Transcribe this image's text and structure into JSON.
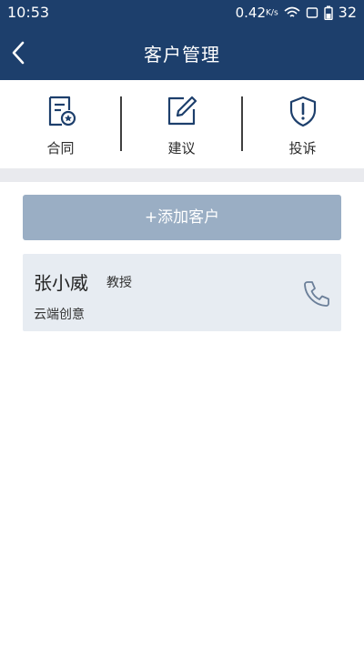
{
  "status_bar": {
    "time": "10:53",
    "network_speed": "0.42",
    "speed_unit": "K/s",
    "battery": "32"
  },
  "header": {
    "title": "客户管理",
    "back_icon": "chevron-left-icon"
  },
  "toolbar": [
    {
      "label": "合同",
      "icon": "contract-document-icon"
    },
    {
      "label": "建议",
      "icon": "edit-icon"
    },
    {
      "label": "投诉",
      "icon": "shield-alert-icon"
    }
  ],
  "add_customer": {
    "label": "+添加客户"
  },
  "customers": [
    {
      "name": "张小威",
      "title": "教授",
      "company": "云端创意",
      "action_icon": "phone-icon"
    }
  ],
  "colors": {
    "header": "#1d3f6c",
    "add_button": "#9aaec4",
    "card": "#e7ecf2",
    "band": "#e9eaee",
    "icon_stroke": "#1d3f6c"
  }
}
